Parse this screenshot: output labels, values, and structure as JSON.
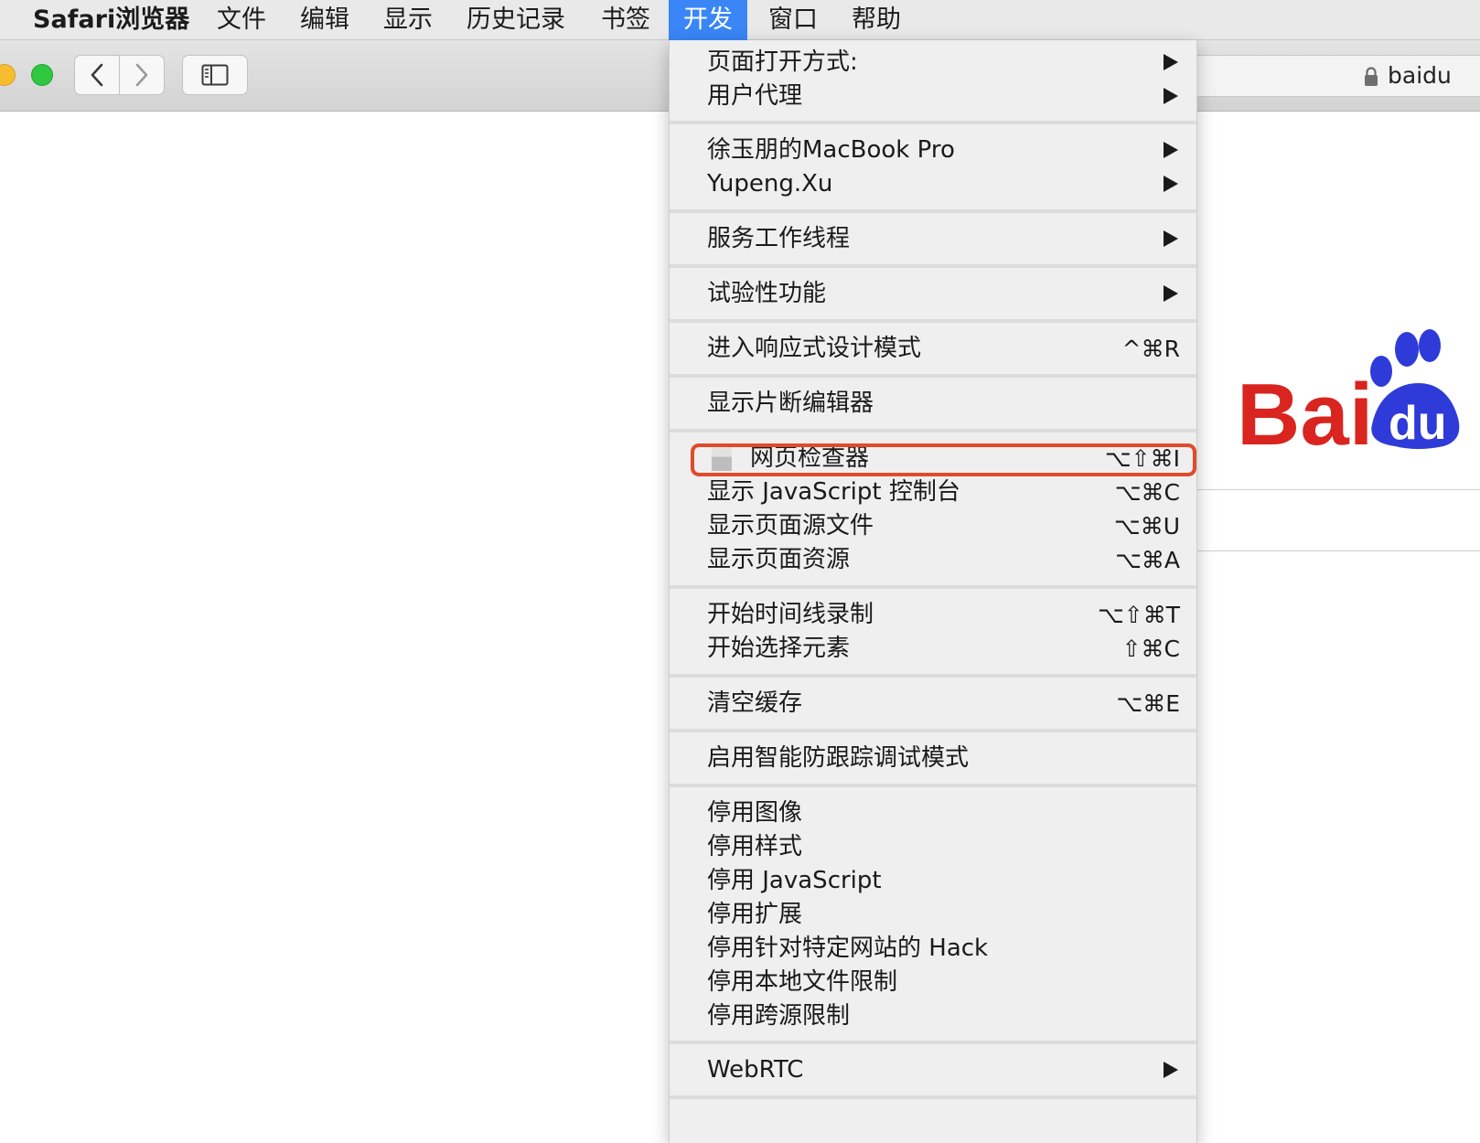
{
  "menubar": {
    "app_name": "Safari浏览器",
    "items": [
      "文件",
      "编辑",
      "显示",
      "历史记录",
      "书签",
      "开发",
      "窗口",
      "帮助"
    ],
    "active_item": "开发"
  },
  "toolbar": {
    "url": "baidu"
  },
  "page": {
    "logo_text": "Bai",
    "logo_tail": "du"
  },
  "menu": {
    "page_open_with": "页面打开方式:",
    "user_agent": "用户代理",
    "device_macbook": "徐玉朋的MacBook Pro",
    "device_user": "Yupeng.Xu",
    "service_workers": "服务工作线程",
    "experimental_features": "试验性功能",
    "responsive_design": "进入响应式设计模式",
    "responsive_design_shortcut": "^⌘R",
    "snippet_editor": "显示片断编辑器",
    "web_inspector": "网页检查器",
    "web_inspector_shortcut": "⌥⇧⌘I",
    "js_console": "显示 JavaScript 控制台",
    "js_console_shortcut": "⌥⌘C",
    "page_source": "显示页面源文件",
    "page_source_shortcut": "⌥⌘U",
    "page_resources": "显示页面资源",
    "page_resources_shortcut": "⌥⌘A",
    "timeline_recording": "开始时间线录制",
    "timeline_recording_shortcut": "⌥⇧⌘T",
    "select_element": "开始选择元素",
    "select_element_shortcut": "⇧⌘C",
    "empty_caches": "清空缓存",
    "empty_caches_shortcut": "⌥⌘E",
    "itp_debug": "启用智能防跟踪调试模式",
    "disable_images": "停用图像",
    "disable_styles": "停用样式",
    "disable_javascript": "停用 JavaScript",
    "disable_extensions": "停用扩展",
    "disable_site_hacks": "停用针对特定网站的 Hack",
    "disable_local_file_restrictions": "停用本地文件限制",
    "disable_cross_origin_restrictions": "停用跨源限制",
    "webrtc": "WebRTC"
  },
  "colors": {
    "menu_highlight": "#3a86f6",
    "annotation": "#e14a2a",
    "baidu_red": "#d9241f",
    "baidu_blue": "#2e3bd8"
  }
}
